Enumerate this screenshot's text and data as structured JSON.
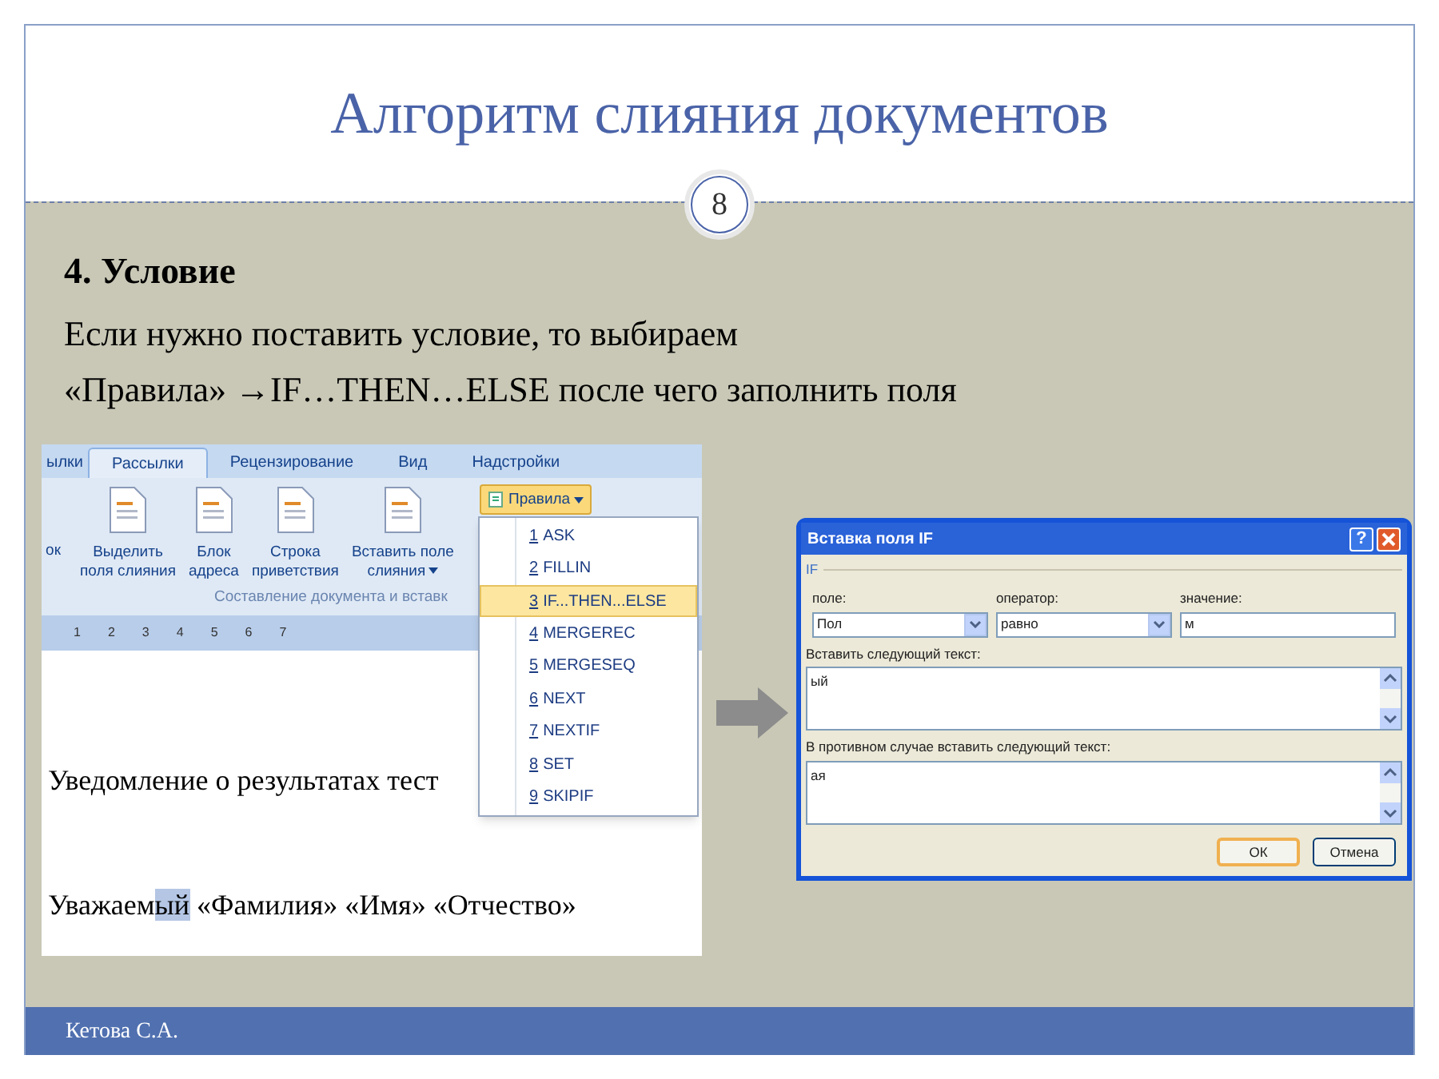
{
  "slide": {
    "title": "Алгоритм слияния документов",
    "page_number": "8",
    "heading": "4. Условие",
    "lines": [
      "Если нужно поставить условие, то выбираем",
      "«Правила» →IF…THEN…ELSE после чего заполнить поля"
    ],
    "footer": "Кетова С.А."
  },
  "word": {
    "tabs": [
      {
        "label": "ылки",
        "selected": false
      },
      {
        "label": "Рассылки",
        "selected": true
      },
      {
        "label": "Рецензирование",
        "selected": false
      },
      {
        "label": "Вид",
        "selected": false
      },
      {
        "label": "Надстройки",
        "selected": false
      }
    ],
    "cut_button": "ок",
    "ribbon_buttons": [
      {
        "lines": [
          "Выделить",
          "поля слияния"
        ],
        "dropdown": false
      },
      {
        "lines": [
          "Блок",
          "адреса"
        ],
        "dropdown": false
      },
      {
        "lines": [
          "Строка",
          "приветствия"
        ],
        "dropdown": false
      },
      {
        "lines": [
          "Вставить поле",
          "слияния"
        ],
        "dropdown": true
      }
    ],
    "rules_button": "Правила",
    "group_label": "Составление документа и вставк",
    "ruler_marks": [
      "1",
      "2",
      "3",
      "4",
      "5",
      "6",
      "7"
    ],
    "menu": [
      {
        "number": "1",
        "label": "ASK",
        "selected": false
      },
      {
        "number": "2",
        "label": "FILLIN",
        "selected": false
      },
      {
        "number": "3",
        "label": "IF...THEN...ELSE",
        "selected": true
      },
      {
        "number": "4",
        "label": "MERGEREC",
        "selected": false
      },
      {
        "number": "5",
        "label": "MERGESEQ",
        "selected": false
      },
      {
        "number": "6",
        "label": "NEXT",
        "selected": false
      },
      {
        "number": "7",
        "label": "NEXTIF",
        "selected": false
      },
      {
        "number": "8",
        "label": "SET",
        "selected": false
      },
      {
        "number": "9",
        "label": "SKIPIF",
        "selected": false
      }
    ],
    "document": {
      "notice": "Уведомление о результатах  тест",
      "greeting": [
        {
          "text": "Уважаем",
          "highlighted": false
        },
        {
          "text": "ый",
          "highlighted": true
        },
        {
          "text": " «Фамилия» «Имя» «Отчество»",
          "highlighted": false
        }
      ]
    }
  },
  "dialog": {
    "title": "Вставка поля IF",
    "help_button": "?",
    "group": "IF",
    "fields": [
      {
        "label": "поле:",
        "value": "Пол",
        "kind": "dropdown"
      },
      {
        "label": "оператор:",
        "value": "равно",
        "kind": "dropdown"
      },
      {
        "label": "значение:",
        "value": "м",
        "kind": "text"
      }
    ],
    "text_areas": [
      {
        "label": "Вставить следующий текст:",
        "value": "ый"
      },
      {
        "label": "В противном случае вставить следующий текст:",
        "value": "ая"
      }
    ],
    "buttons": [
      {
        "label": "ОК",
        "default": true
      },
      {
        "label": "Отмена",
        "default": false
      }
    ]
  }
}
